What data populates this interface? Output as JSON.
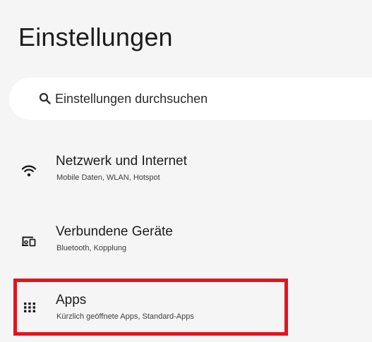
{
  "header": {
    "title": "Einstellungen"
  },
  "search": {
    "placeholder": "Einstellungen durchsuchen",
    "icon": "search-icon"
  },
  "settings": {
    "items": [
      {
        "title": "Netzwerk und Internet",
        "subtitle": "Mobile Daten, WLAN, Hotspot",
        "icon": "wifi-icon"
      },
      {
        "title": "Verbundene Geräte",
        "subtitle": "Bluetooth, Kopplung",
        "icon": "connected-devices-icon"
      },
      {
        "title": "Apps",
        "subtitle": "Kürzlich geöffnete Apps, Standard-Apps",
        "icon": "apps-grid-icon",
        "highlighted": true
      }
    ]
  },
  "colors": {
    "background": "#f5f5f5",
    "search_background": "#ffffff",
    "highlight": "#e4141c",
    "text_primary": "#1c1c1c",
    "text_secondary": "#3d3d3d"
  }
}
